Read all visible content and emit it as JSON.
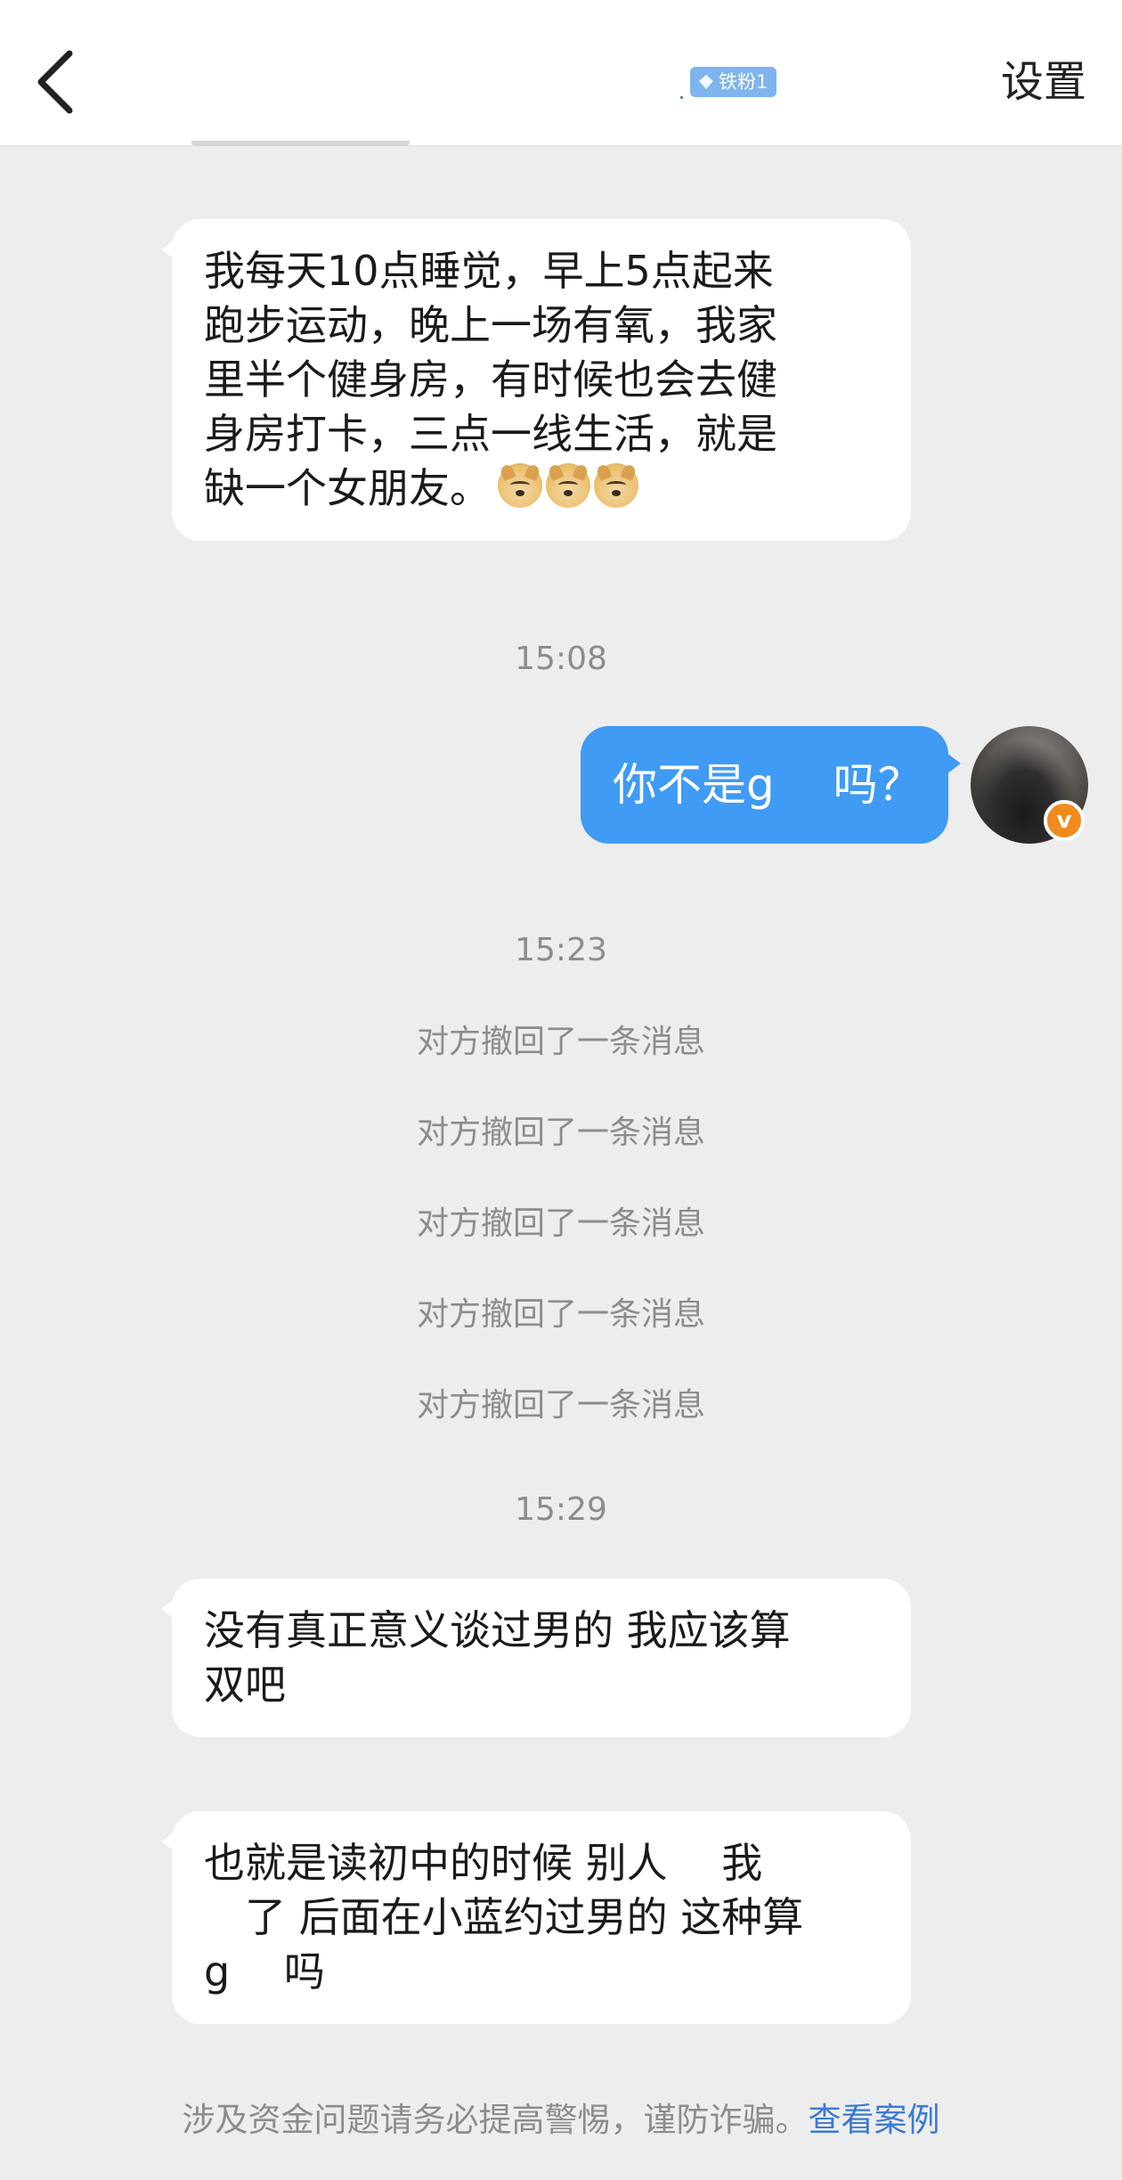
{
  "header": {
    "back_icon": "chevron-left-icon",
    "fan_badge": "铁粉1",
    "fan_badge_icon": "diamond-icon",
    "settings_label": "设置"
  },
  "messages": {
    "in1_lines": [
      "我每天10点睡觉，早上5点起来",
      "跑步运动，晚上一场有氧，我家",
      "里半个健身房，有时候也会去健",
      "身房打卡，三点一线生活，就是",
      "缺一个女朋友。"
    ],
    "in1_emoji": [
      "doge-emoji",
      "doge-emoji",
      "doge-emoji"
    ],
    "time1": "15:08",
    "out1": "你不是g　 吗？",
    "time2": "15:23",
    "recalls": [
      "对方撤回了一条消息",
      "对方撤回了一条消息",
      "对方撤回了一条消息",
      "对方撤回了一条消息",
      "对方撤回了一条消息"
    ],
    "time3": "15:29",
    "in2_lines": [
      "没有真正意义谈过男的 我应该算",
      "双吧"
    ],
    "in3_lines": [
      "也就是读初中的时候 别人　 我",
      "　了 后面在小蓝约过男的 这种算",
      "g　 吗"
    ]
  },
  "footer": {
    "warning_text": "涉及资金问题请务必提高警惕，谨防诈骗。",
    "link_text": "查看案例"
  },
  "colors": {
    "background": "#ededed",
    "outgoing_bubble": "#3f9bf3",
    "incoming_bubble": "#ffffff",
    "badge": "#7fb4ee",
    "link": "#3a7bd5",
    "verified": "#f28a1e"
  }
}
